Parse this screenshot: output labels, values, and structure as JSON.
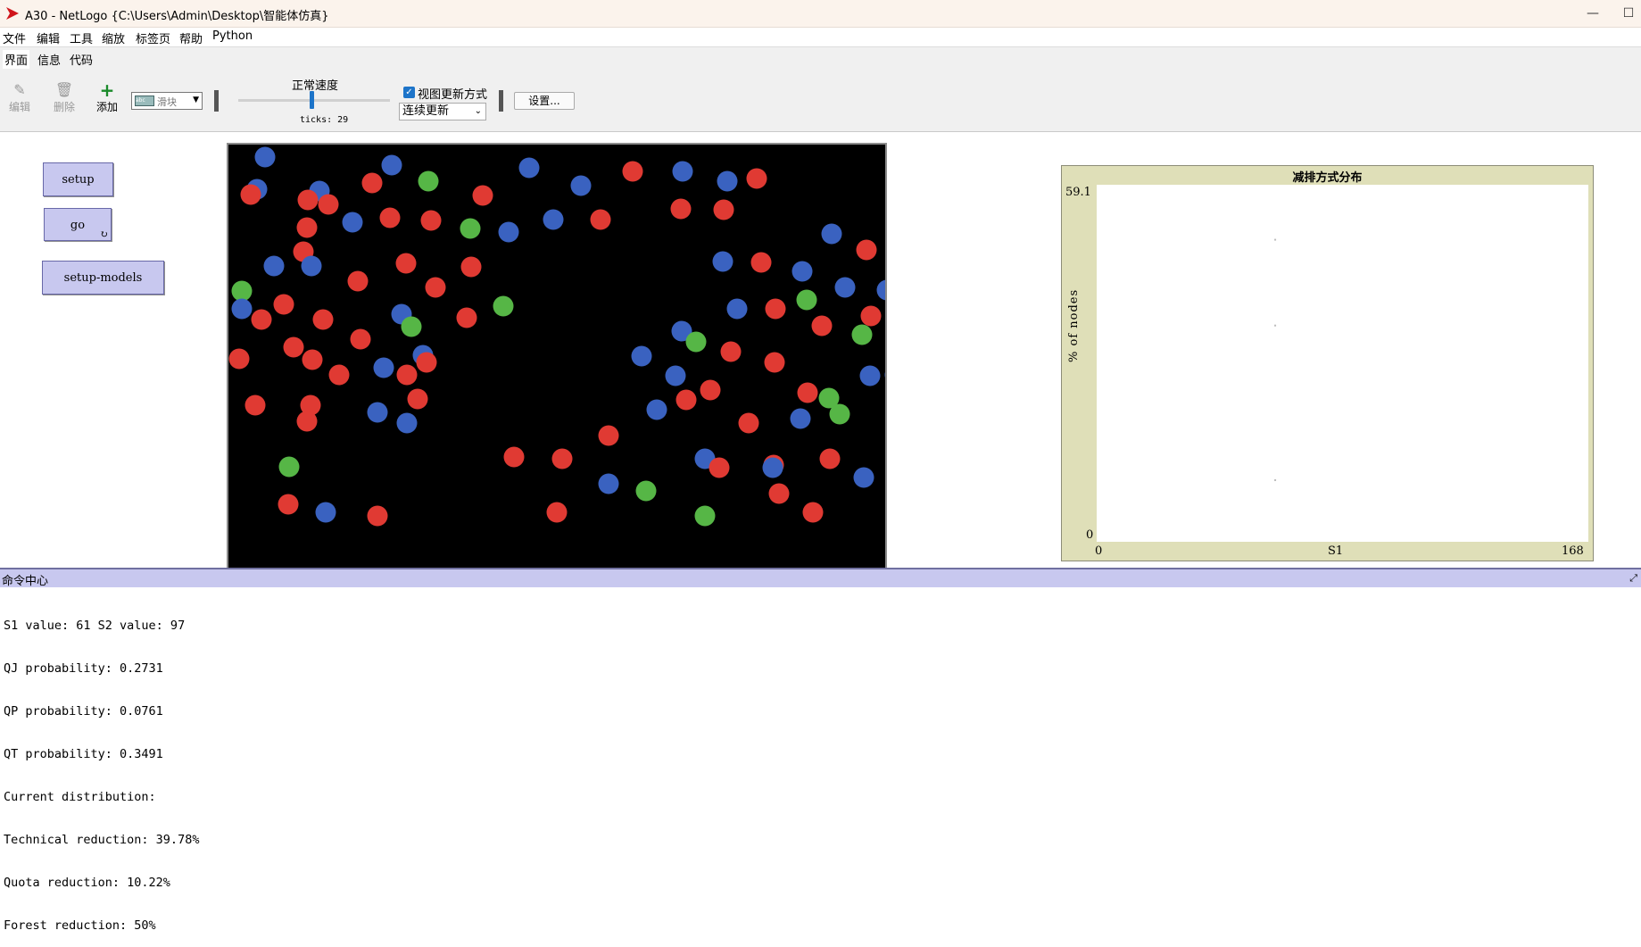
{
  "window": {
    "title": "A30 - NetLogo {C:\\Users\\Admin\\Desktop\\智能体仿真}",
    "minimize_glyph": "—",
    "maximize_glyph": "☐"
  },
  "menu": [
    "文件",
    "编辑",
    "工具",
    "缩放",
    "标签页",
    "帮助",
    "Python"
  ],
  "tabs": [
    "界面",
    "信息",
    "代码"
  ],
  "toolbar": {
    "edit_label": "编辑",
    "delete_label": "删除",
    "add_label": "添加",
    "widget_type": "滑块",
    "speed_label": "正常速度",
    "speed_fraction": 0.48,
    "ticks_label": "ticks: 29",
    "view_updates_label": "视图更新方式",
    "view_updates_checked": true,
    "update_mode": "连续更新",
    "settings_label": "设置..."
  },
  "buttons": {
    "setup": "setup",
    "go": "go",
    "setup_models": "setup-models"
  },
  "plot": {
    "title": "减排方式分布",
    "ylabel": "% of nodes",
    "xlabel": "S1",
    "y_max": "59.1",
    "y_min": "0",
    "x_min": "0",
    "x_max": "168"
  },
  "chart_data": {
    "type": "scatter",
    "title": "减排方式分布",
    "xlabel": "S1",
    "ylabel": "% of nodes",
    "xlim": [
      0,
      168
    ],
    "ylim": [
      0,
      59.1
    ],
    "series": [
      {
        "color": "#bbbbbb",
        "points": [
          [
            61,
            50
          ],
          [
            61,
            35.8
          ],
          [
            61,
            10.2
          ]
        ]
      }
    ]
  },
  "world": {
    "colors": {
      "red": "#e03a33",
      "blue": "#3a62c0",
      "green": "#56b646"
    },
    "agents": [
      [
        "blue",
        29,
        2
      ],
      [
        "green",
        835,
        2
      ],
      [
        "blue",
        171,
        11
      ],
      [
        "blue",
        325,
        14
      ],
      [
        "red",
        441,
        18
      ],
      [
        "blue",
        497,
        18
      ],
      [
        "red",
        149,
        31
      ],
      [
        "green",
        212,
        29
      ],
      [
        "red",
        580,
        26
      ],
      [
        "blue",
        383,
        34
      ],
      [
        "blue",
        547,
        29
      ],
      [
        "red",
        779,
        32
      ],
      [
        "blue",
        20,
        38
      ],
      [
        "blue",
        90,
        40
      ],
      [
        "red",
        273,
        45
      ],
      [
        "red",
        13,
        44
      ],
      [
        "red",
        77,
        50
      ],
      [
        "red",
        100,
        55
      ],
      [
        "red",
        495,
        60
      ],
      [
        "red",
        543,
        61
      ],
      [
        "red",
        169,
        70
      ],
      [
        "blue",
        127,
        75
      ],
      [
        "red",
        215,
        73
      ],
      [
        "blue",
        352,
        72
      ],
      [
        "red",
        405,
        72
      ],
      [
        "red",
        76,
        81
      ],
      [
        "green",
        259,
        82
      ],
      [
        "blue",
        302,
        86
      ],
      [
        "blue",
        664,
        88
      ],
      [
        "red",
        812,
        97
      ],
      [
        "blue",
        764,
        98
      ],
      [
        "red",
        703,
        106
      ],
      [
        "red",
        72,
        108
      ],
      [
        "blue",
        39,
        124
      ],
      [
        "blue",
        81,
        124
      ],
      [
        "red",
        187,
        121
      ],
      [
        "red",
        260,
        125
      ],
      [
        "blue",
        542,
        119
      ],
      [
        "red",
        585,
        120
      ],
      [
        "blue",
        631,
        130
      ],
      [
        "red",
        771,
        140
      ],
      [
        "green",
        806,
        141
      ],
      [
        "red",
        133,
        141
      ],
      [
        "red",
        220,
        148
      ],
      [
        "green",
        3,
        152
      ],
      [
        "green",
        830,
        152
      ],
      [
        "blue",
        679,
        148
      ],
      [
        "blue",
        726,
        151
      ],
      [
        "red",
        50,
        167
      ],
      [
        "green",
        296,
        169
      ],
      [
        "green",
        636,
        162
      ],
      [
        "blue",
        3,
        172
      ],
      [
        "blue",
        558,
        172
      ],
      [
        "blue",
        821,
        172
      ],
      [
        "red",
        25,
        184
      ],
      [
        "red",
        94,
        184
      ],
      [
        "blue",
        182,
        178
      ],
      [
        "green",
        193,
        192
      ],
      [
        "red",
        255,
        182
      ],
      [
        "red",
        601,
        172
      ],
      [
        "red",
        708,
        180
      ],
      [
        "red",
        786,
        178
      ],
      [
        "blue",
        496,
        197
      ],
      [
        "red",
        653,
        191
      ],
      [
        "red",
        740,
        190
      ],
      [
        "green",
        512,
        209
      ],
      [
        "red",
        136,
        206
      ],
      [
        "green",
        698,
        201
      ],
      [
        "red",
        61,
        215
      ],
      [
        "red",
        82,
        229
      ],
      [
        "red",
        551,
        220
      ],
      [
        "blue",
        206,
        224
      ],
      [
        "blue",
        451,
        225
      ],
      [
        "red",
        210,
        232
      ],
      [
        "red",
        0,
        228
      ],
      [
        "blue",
        162,
        238
      ],
      [
        "red",
        112,
        246
      ],
      [
        "red",
        188,
        246
      ],
      [
        "blue",
        489,
        247
      ],
      [
        "red",
        600,
        232
      ],
      [
        "blue",
        707,
        247
      ],
      [
        "blue",
        735,
        246
      ],
      [
        "red",
        754,
        234
      ],
      [
        "red",
        809,
        230
      ],
      [
        "red",
        815,
        228
      ],
      [
        "red",
        528,
        263
      ],
      [
        "red",
        637,
        266
      ],
      [
        "green",
        661,
        272
      ],
      [
        "red",
        200,
        273
      ],
      [
        "red",
        501,
        274
      ],
      [
        "red",
        18,
        280
      ],
      [
        "red",
        80,
        280
      ],
      [
        "green",
        673,
        290
      ],
      [
        "blue",
        155,
        288
      ],
      [
        "blue",
        468,
        285
      ],
      [
        "blue",
        188,
        300
      ],
      [
        "red",
        76,
        298
      ],
      [
        "red",
        571,
        300
      ],
      [
        "blue",
        629,
        295
      ],
      [
        "blue",
        741,
        300
      ],
      [
        "red",
        802,
        302
      ],
      [
        "red",
        812,
        312
      ],
      [
        "red",
        414,
        314
      ],
      [
        "red",
        308,
        338
      ],
      [
        "red",
        362,
        340
      ],
      [
        "blue",
        522,
        340
      ],
      [
        "red",
        662,
        340
      ],
      [
        "red",
        538,
        350
      ],
      [
        "red",
        599,
        347
      ],
      [
        "blue",
        598,
        350
      ],
      [
        "blue",
        772,
        348
      ],
      [
        "green",
        56,
        349
      ],
      [
        "blue",
        700,
        361
      ],
      [
        "blue",
        414,
        368
      ],
      [
        "red",
        808,
        370
      ],
      [
        "green",
        456,
        376
      ],
      [
        "red",
        605,
        379
      ],
      [
        "red",
        55,
        391
      ],
      [
        "blue",
        97,
        400
      ],
      [
        "red",
        356,
        400
      ],
      [
        "red",
        643,
        400
      ],
      [
        "red",
        760,
        396
      ],
      [
        "green",
        522,
        404
      ],
      [
        "red",
        155,
        404
      ]
    ]
  },
  "command_center": {
    "title": "命令中心",
    "lines": [
      "S1 value: 61 S2 value: 97",
      "QJ probability: 0.2731",
      "QP probability: 0.0761",
      "QT probability: 0.3491",
      "Current distribution:",
      "Technical reduction: 39.78%",
      "Quota reduction: 10.22%",
      "Forest reduction: 50%"
    ]
  }
}
